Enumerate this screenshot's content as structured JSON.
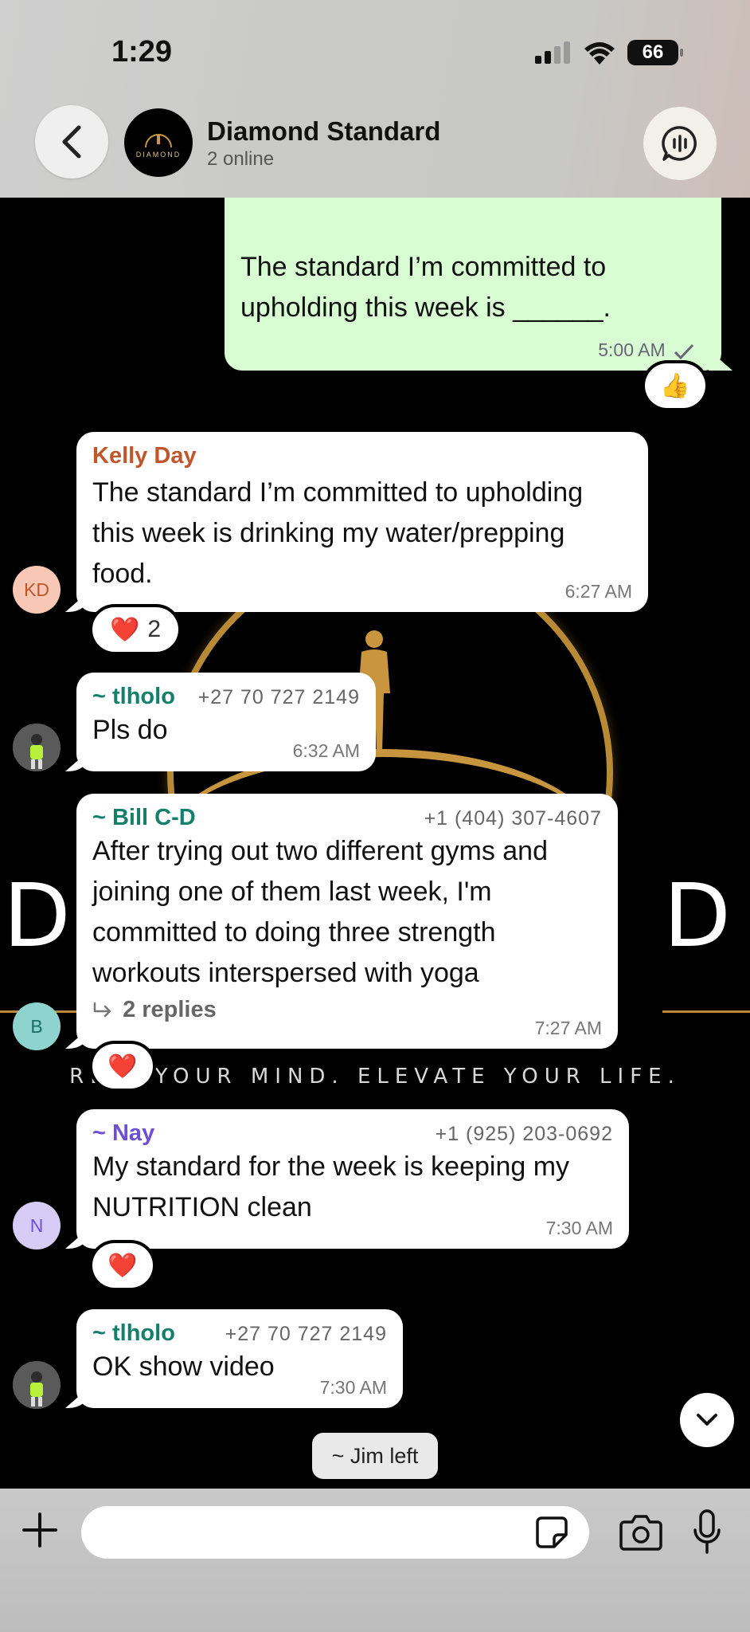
{
  "status_bar": {
    "time": "1:29",
    "battery": "66"
  },
  "header": {
    "title": "Diamond Standard",
    "subtitle": "2 online",
    "avatar_text": "DIAMOND"
  },
  "messages": [
    {
      "direction": "out",
      "text_line1": "The standard I’m committed to",
      "text_line2": "upholding this week is ______.",
      "time": "5:00 AM",
      "reaction": "👍"
    },
    {
      "direction": "in",
      "sender": "Kelly Day",
      "sender_color": "#c0562b",
      "avatar": "KD",
      "text": "The standard I’m committed to upholding this week is drinking my water/prepping food.",
      "time": "6:27 AM",
      "reaction": "❤️",
      "reaction_count": "2"
    },
    {
      "direction": "in",
      "sender": "~ tlholo",
      "sender_color": "#14806c",
      "phone": "+27 70 727 2149",
      "text": "Pls do",
      "time": "6:32 AM"
    },
    {
      "direction": "in",
      "sender": "~ Bill C-D",
      "sender_color": "#14806c",
      "phone": "+1 (404) 307-4607",
      "avatar": "B",
      "text": "After trying out two different gyms and joining one of them last week, I'm committed to doing three strength workouts interspersed with yoga",
      "replies": "2 replies",
      "time": "7:27 AM",
      "reaction": "❤️"
    },
    {
      "direction": "in",
      "sender": "~ Nay",
      "sender_color": "#6e4fd6",
      "phone": "+1 (925) 203-0692",
      "avatar": "N",
      "text": "My standard for the week is keeping my NUTRITION clean",
      "time": "7:30 AM",
      "reaction": "❤️"
    },
    {
      "direction": "in",
      "sender": "~ tlholo",
      "sender_color": "#14806c",
      "phone": "+27 70 727 2149",
      "text": "OK show video",
      "time": "7:30 AM"
    }
  ],
  "system_message": "~ Jim left",
  "wallpaper": {
    "letter_left": "D",
    "letter_right": "D",
    "tagline": "RE  E YOUR MIND. ELEVATE YOUR LIFE."
  },
  "composer": {
    "placeholder": ""
  },
  "icons": [
    "back-chevron-icon",
    "call-icon",
    "plus-icon",
    "sticker-icon",
    "camera-icon",
    "mic-icon",
    "chevron-down-icon",
    "reply-arrow-icon"
  ],
  "colors": {
    "outgoing_bubble": "#d9fdd3",
    "incoming_bubble": "#ffffff"
  }
}
